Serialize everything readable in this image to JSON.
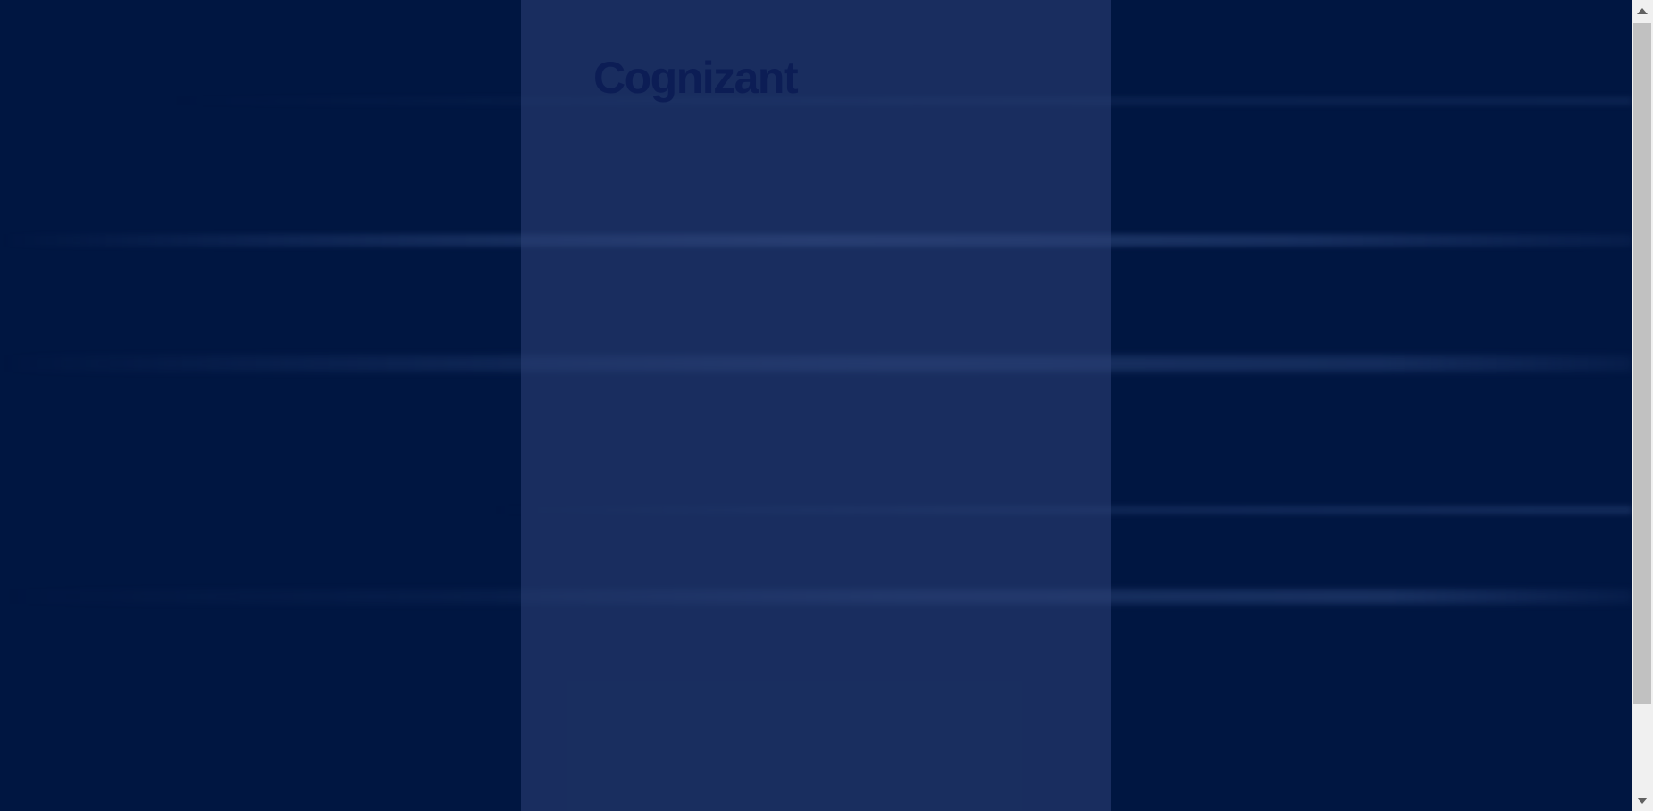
{
  "brand": {
    "logo_text": "Cognizant"
  },
  "colors": {
    "background": "#001641",
    "panel": "#1e2f5c",
    "logo": "#0c1d55",
    "scrollbar_track": "#f0f0f0",
    "scrollbar_thumb": "#c1c1c1"
  },
  "scrollbar": {
    "up_icon": "triangle-up",
    "down_icon": "triangle-down"
  }
}
